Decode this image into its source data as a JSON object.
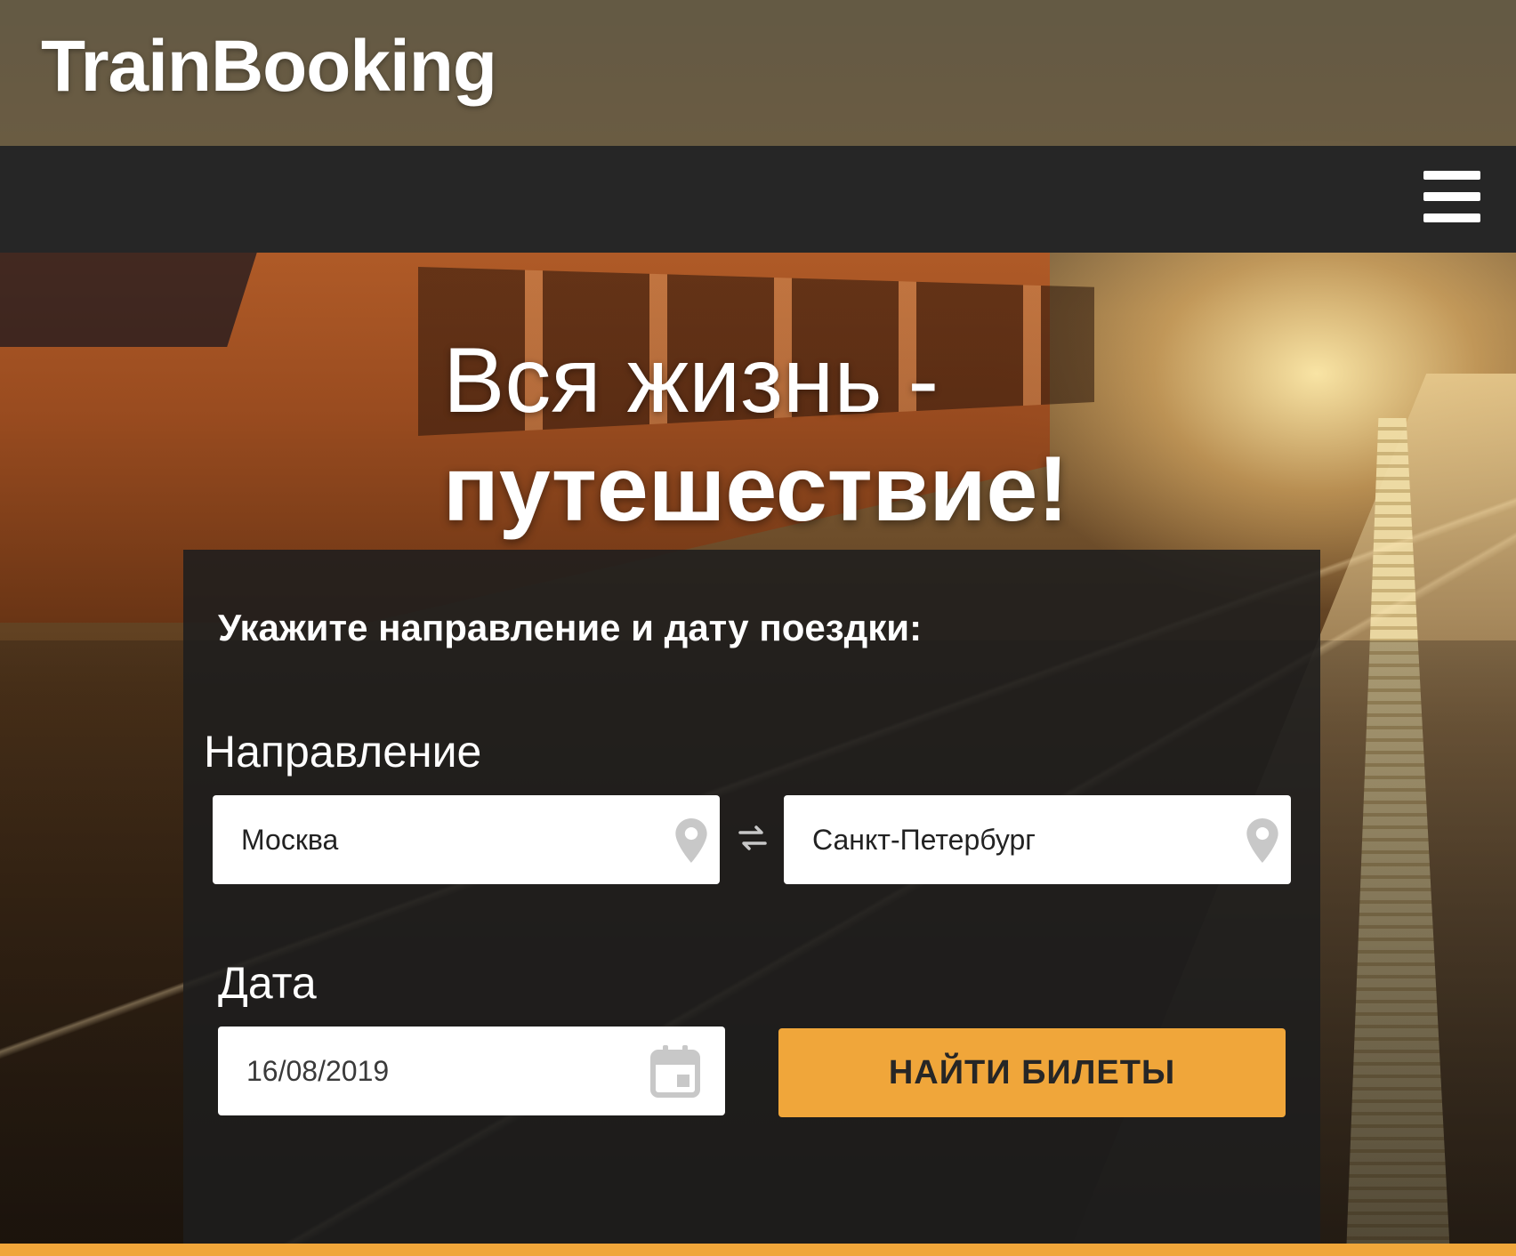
{
  "header": {
    "logo": "TrainBooking"
  },
  "nav": {
    "menu_icon": "hamburger-menu-icon"
  },
  "hero": {
    "line1": "Вся жизнь -",
    "line2": "путешествие!"
  },
  "search": {
    "title": "Укажите направление и дату поездки:",
    "direction_label": "Направление",
    "from_value": "Москва",
    "to_value": "Санкт-Петербург",
    "date_label": "Дата",
    "date_value": "16/08/2019",
    "submit_label": "НАЙТИ БИЛЕТЫ",
    "icons": {
      "location": "location-pin-icon",
      "swap": "swap-arrows-icon",
      "calendar": "calendar-icon"
    }
  },
  "colors": {
    "accent": "#f0a63a",
    "navbar": "#262626",
    "panel": "#1e1e1e",
    "text_light": "#ffffff",
    "icon_gray": "#c8c8c8"
  }
}
